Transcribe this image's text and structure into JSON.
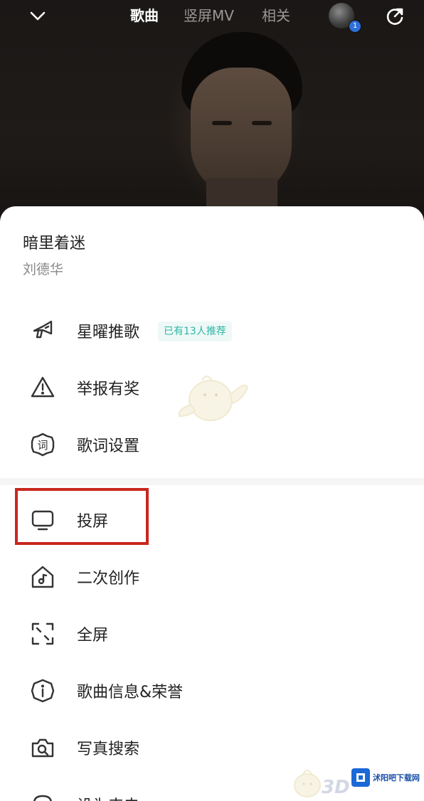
{
  "header": {
    "tabs": [
      {
        "label": "歌曲",
        "active": true
      },
      {
        "label": "竖屏MV",
        "active": false
      },
      {
        "label": "相关",
        "active": false
      }
    ],
    "avatar_badge": "1"
  },
  "song": {
    "title": "暗里着迷",
    "artist": "刘德华"
  },
  "menu": [
    {
      "label": "星曜推歌",
      "icon": "megaphone-icon",
      "tag": "已有13人推荐"
    },
    {
      "label": "举报有奖",
      "icon": "warning-icon"
    },
    {
      "label": "歌词设置",
      "icon": "lyrics-icon",
      "icon_text": "词"
    },
    {
      "label": "投屏",
      "icon": "cast-screen-icon",
      "highlighted": true
    },
    {
      "label": "二次创作",
      "icon": "music-house-icon"
    },
    {
      "label": "全屏",
      "icon": "fullscreen-icon"
    },
    {
      "label": "歌曲信息&荣誉",
      "icon": "info-icon"
    },
    {
      "label": "写真搜索",
      "icon": "photo-search-icon"
    },
    {
      "label": "设为来电",
      "icon": "ringtone-icon"
    }
  ],
  "colors": {
    "highlight": "#c8271e",
    "tag_text": "#2cb5a5",
    "tag_bg": "#eef9f7"
  },
  "watermark": {
    "logo_text": "3D",
    "brand": "沭阳吧下载网"
  }
}
